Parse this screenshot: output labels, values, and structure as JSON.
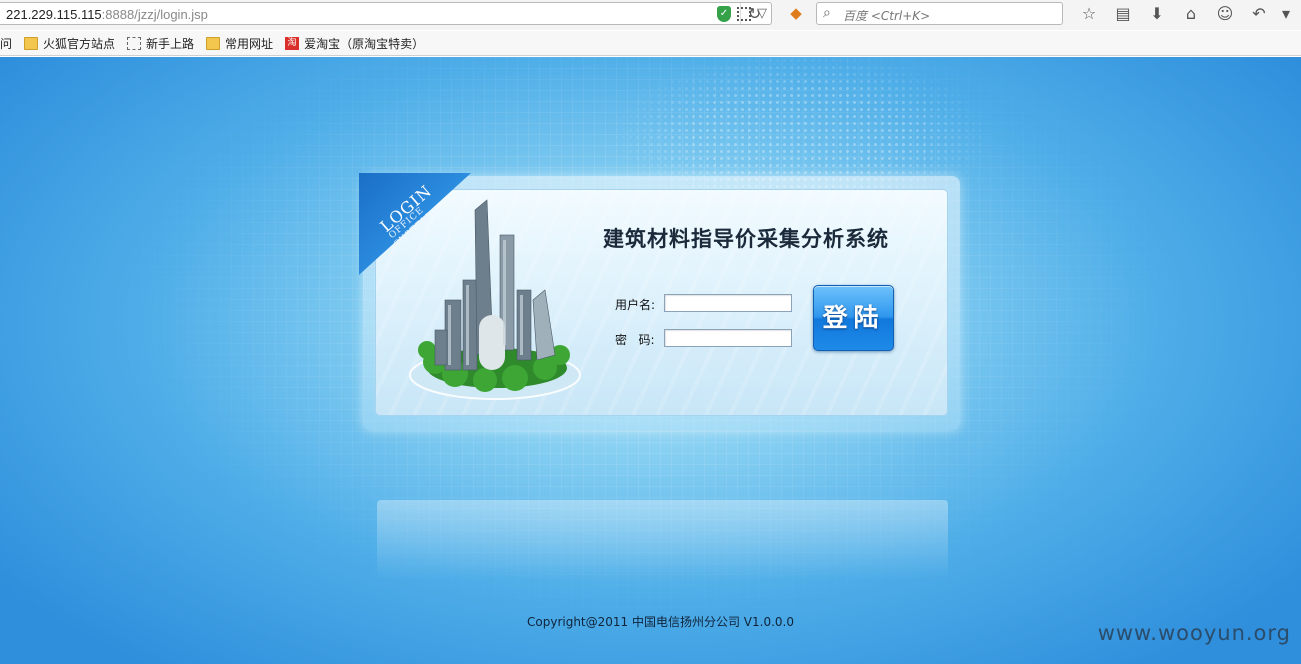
{
  "browser": {
    "url_host": "221.229.115.115",
    "url_path": ":8888/jzzj/login.jsp",
    "search_placeholder": "百度 <Ctrl+K>",
    "bookmarks": [
      {
        "label": "问",
        "icon": "none"
      },
      {
        "label": "火狐官方站点",
        "icon": "folder-icon"
      },
      {
        "label": "新手上路",
        "icon": "dashed-page-icon"
      },
      {
        "label": "常用网址",
        "icon": "folder-icon"
      },
      {
        "label": "爱淘宝（原淘宝特卖）",
        "icon": "taobao-icon",
        "icon_text": "淘"
      }
    ]
  },
  "login": {
    "ribbon_line1": "LOGIN",
    "ribbon_line2": "OFFICE SYSTEM",
    "system_title": "建筑材料指导价采集分析系统",
    "username_label": "用户名:",
    "password_label": "密   码:",
    "username_value": "",
    "password_value": "",
    "login_button": "登陆"
  },
  "footer": {
    "copyright": "Copyright@2011 中国电信扬州分公司 V1.0.0.0",
    "watermark": "www.wooyun.org"
  },
  "colors": {
    "background_center": "#c6ecfb",
    "background_edge": "#2f8fdc",
    "button_blue": "#1e8ae8",
    "ribbon_blue": "#2d8ee0"
  }
}
